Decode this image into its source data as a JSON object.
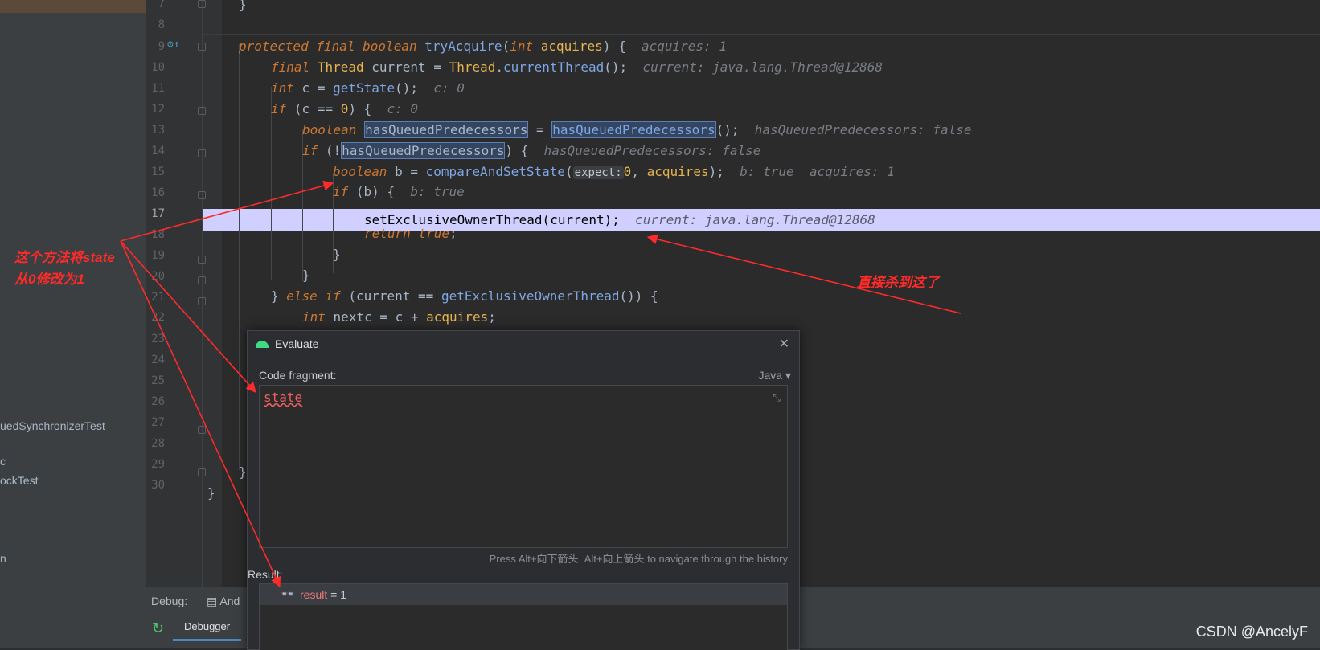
{
  "project_panel": {
    "items": [
      "uedSynchronizerTest",
      "c",
      "ockTest",
      "n"
    ]
  },
  "line_numbers": [
    "7",
    "8",
    "9",
    "10",
    "11",
    "12",
    "13",
    "14",
    "15",
    "16",
    "17",
    "18",
    "19",
    "20",
    "21",
    "22",
    "23",
    "24",
    "25",
    "26",
    "27",
    "28",
    "29",
    "30"
  ],
  "code": {
    "l7": "}",
    "l9_protected": "protected",
    "l9_final": "final",
    "l9_boolean": "boolean",
    "l9_method": "tryAcquire",
    "l9_int": "int",
    "l9_param": "acquires",
    "l9_hint": "acquires: 1",
    "l10_final": "final",
    "l10_type": "Thread",
    "l10_var": "current",
    "l10_cls": "Thread",
    "l10_call": "currentThread",
    "l10_hint": "current: java.lang.Thread@12868",
    "l11_int": "int",
    "l11_var": "c",
    "l11_call": "getState",
    "l11_hint": "c: 0",
    "l12_if": "if",
    "l12_cond": "(c == ",
    "l12_zero": "0",
    "l12_hint": "c: 0",
    "l13_boolean": "boolean",
    "l13_var": "hasQueuedPredecessors",
    "l13_call": "hasQueuedPredecessors",
    "l13_hint": "hasQueuedPredecessors: false",
    "l14_if": "if",
    "l14_var": "hasQueuedPredecessors",
    "l14_hint": "hasQueuedPredecessors: false",
    "l15_boolean": "boolean",
    "l15_var": "b",
    "l15_call": "compareAndSetState",
    "l15_param_hint": "expect:",
    "l15_zero": "0",
    "l15_arg": "acquires",
    "l15_hint": "b: true  acquires: 1",
    "l16_if": "if",
    "l16_cond": "(b) {",
    "l16_hint": "b: true",
    "l17_stmt": "setExclusiveOwnerThread(current);",
    "l17_hint": "current: java.lang.Thread@12868",
    "l18_return": "return",
    "l18_true": "true",
    "l19": "}",
    "l20": "}",
    "l21_else": "else",
    "l21_if": "if",
    "l21_cond": "(current == ",
    "l21_call": "getExclusiveOwnerThread",
    "l22_int": "int",
    "l22_rest": "nextc = c + ",
    "l22_param": "acquires",
    "l29": "}",
    "l30": "}"
  },
  "evaluate_dialog": {
    "title": "Evaluate",
    "code_fragment_label": "Code fragment:",
    "language": "Java",
    "expression": "state",
    "history_hint": "Press Alt+向下箭头, Alt+向上箭头 to navigate through the history",
    "result_label": "Result:",
    "result_name": "result",
    "result_value": " = 1"
  },
  "debug_panel": {
    "label": "Debug:",
    "tab": "And",
    "debugger_tab": "Debugger"
  },
  "annotations": {
    "left_note_1": "这个方法将state",
    "left_note_2": "从0修改为1",
    "right_note": "直接杀到这了",
    "color": "#ff2a2a"
  },
  "watermark": "CSDN @AncelyF",
  "colors": {
    "current_line": "#cfd0ff",
    "keyword": "#cc7832",
    "method": "#7fa7e4"
  }
}
